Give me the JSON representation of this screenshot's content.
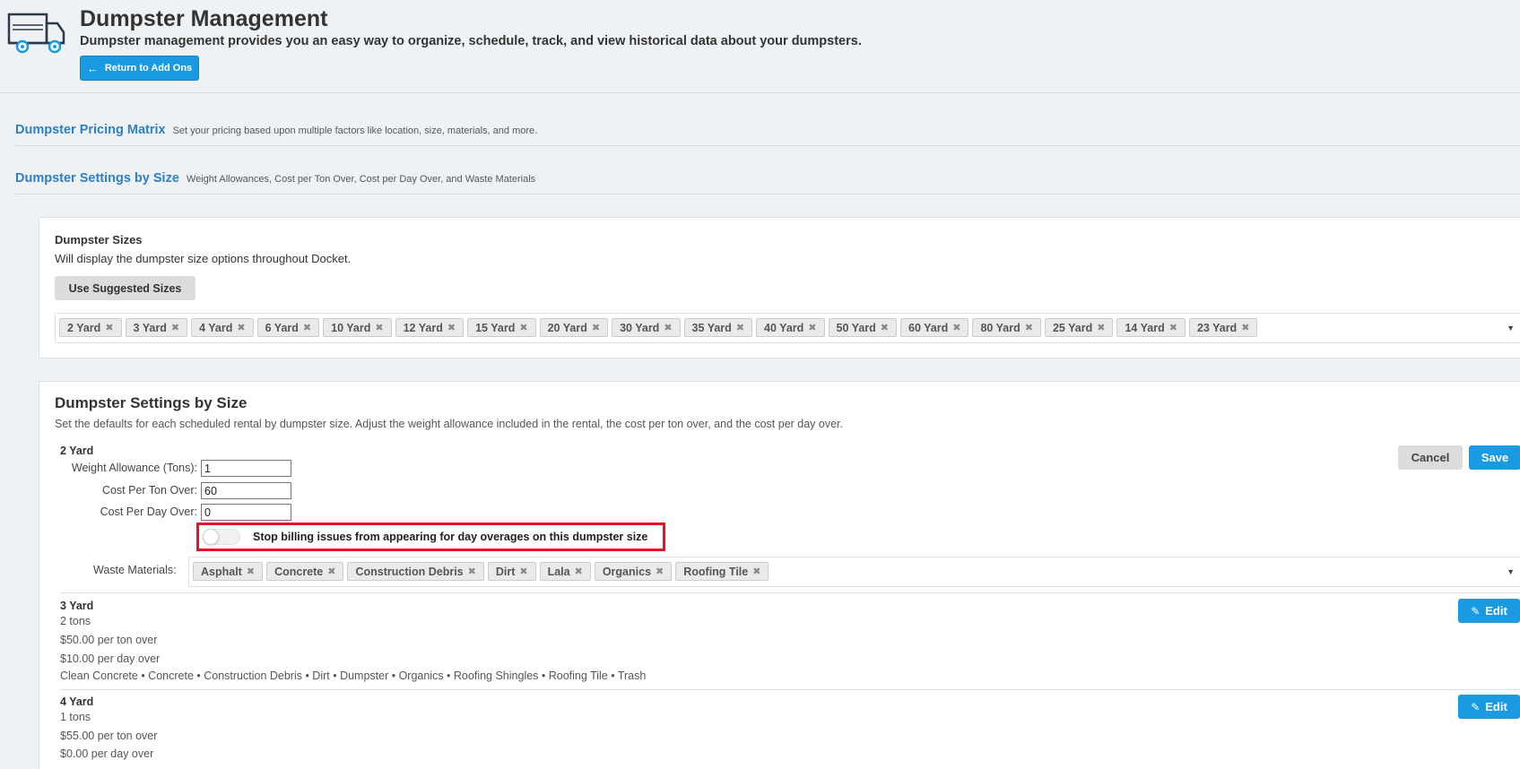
{
  "header": {
    "title": "Dumpster Management",
    "subtitle": "Dumpster management provides you an easy way to organize, schedule, track, and view historical data about your dumpsters.",
    "return_label": "Return to Add Ons",
    "icon": "truck-icon"
  },
  "sections": [
    {
      "name": "Dumpster Pricing Matrix",
      "desc": "Set your pricing based upon multiple factors like location, size, materials, and more."
    },
    {
      "name": "Dumpster Settings by Size",
      "desc": "Weight Allowances, Cost per Ton Over, Cost per Day Over, and Waste Materials"
    }
  ],
  "sizes_card": {
    "title": "Dumpster Sizes",
    "desc": "Will display the dumpster size options throughout Docket.",
    "suggest_label": "Use Suggested Sizes",
    "tags": [
      "2 Yard",
      "3 Yard",
      "4 Yard",
      "6 Yard",
      "10 Yard",
      "12 Yard",
      "15 Yard",
      "20 Yard",
      "30 Yard",
      "35 Yard",
      "40 Yard",
      "50 Yard",
      "60 Yard",
      "80 Yard",
      "25 Yard",
      "14 Yard",
      "23 Yard"
    ]
  },
  "settings_card": {
    "title": "Dumpster Settings by Size",
    "desc": "Set the defaults for each scheduled rental by dumpster size. Adjust the weight allowance included in the rental, the cost per ton over, and the cost per day over.",
    "editing": {
      "size": "2 Yard",
      "weight_label": "Weight Allowance (Tons):",
      "weight_value": "1",
      "ton_label": "Cost Per Ton Over:",
      "ton_value": "60",
      "day_label": "Cost Per Day Over:",
      "day_value": "0",
      "toggle_label": "Stop billing issues from appearing for day overages on this dumpster size",
      "toggle_on": false,
      "waste_label": "Waste Materials:",
      "waste_tags": [
        "Asphalt",
        "Concrete",
        "Construction Debris",
        "Dirt",
        "Lala",
        "Organics",
        "Roofing Tile"
      ],
      "cancel_label": "Cancel",
      "save_label": "Save"
    },
    "rows": [
      {
        "size": "3 Yard",
        "tons": "2 tons",
        "ton_over": "$50.00 per ton over",
        "day_over": "$10.00 per day over",
        "materials": "Clean Concrete • Concrete • Construction Debris • Dirt • Dumpster • Organics • Roofing Shingles • Roofing Tile • Trash",
        "edit_label": "Edit"
      },
      {
        "size": "4 Yard",
        "tons": "1 tons",
        "ton_over": "$55.00 per ton over",
        "day_over": "$0.00 per day over",
        "materials": "",
        "edit_label": "Edit"
      }
    ]
  },
  "colors": {
    "accent": "#1a9ae0",
    "link": "#2e7fc4",
    "highlight": "#e81123"
  }
}
